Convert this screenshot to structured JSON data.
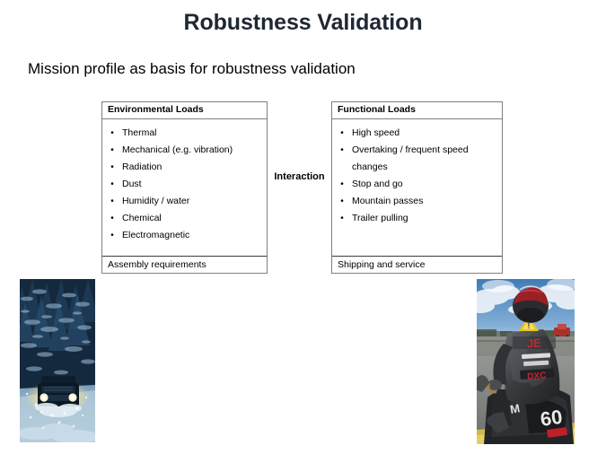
{
  "slide": {
    "title": "Robustness Validation",
    "subtitle": "Mission profile as basis for robustness validation",
    "interaction_label": "Interaction",
    "title_color": "#1f2733",
    "border_color": "#7f7f7f",
    "background_color": "#ffffff"
  },
  "environmental_box": {
    "header": "Environmental Loads",
    "bullet_glyph": "•",
    "items": [
      "Thermal",
      "Mechanical (e.g. vibration)",
      "Radiation",
      "Dust",
      "Humidity / water",
      "Chemical",
      "Electromagnetic"
    ],
    "footer": "Assembly requirements"
  },
  "functional_box": {
    "header": "Functional Loads",
    "bullet_glyph": "•",
    "items": [
      "High speed",
      "Overtaking / frequent speed changes",
      "Stop and go",
      "Mountain passes",
      "Trailer pulling"
    ],
    "footer": "Shipping and service"
  },
  "images": {
    "snow_vehicle": {
      "name": "vehicle-driving-in-snowy-forest-photo",
      "colors": {
        "sky": "#5b7f9e",
        "forest_dark": "#12263a",
        "forest_mid": "#1d3b56",
        "snow_light": "#c3d5e4",
        "snow_mid": "#8fadc6",
        "headlight": "#ffe9a8",
        "vehicle": "#0d1b28"
      }
    },
    "motorcycle_racer": {
      "name": "motorcycle-racer-on-track-photo",
      "colors": {
        "sky": "#5a8fc4",
        "cloud": "#e8eef4",
        "track": "#8d8f8d",
        "asphalt": "#6b6d6b",
        "leather_dark": "#2a2b2d",
        "leather_mid": "#55575a",
        "helmet_red": "#9e2027",
        "patch_yellow": "#e6c220",
        "patch_red": "#c0202a",
        "kerb_yellow": "#e0c24a"
      }
    }
  }
}
